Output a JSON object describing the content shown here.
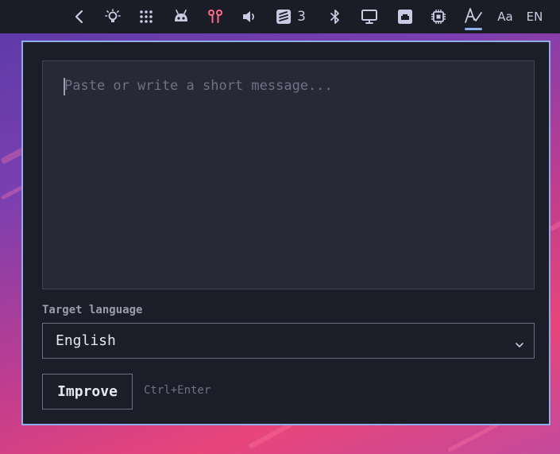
{
  "topbar": {
    "icons": [
      "chevron-left-icon",
      "bulb-icon",
      "grid-icon",
      "robot-icon",
      "earbuds-icon",
      "speaker-icon",
      "stack-icon",
      "bluetooth-icon",
      "monitor-icon",
      "ethernet-icon",
      "chip-icon",
      "signature-icon"
    ],
    "stack_count": "3",
    "font_label": "Aa",
    "lang_label": "EN",
    "accent_color": "#8fb3ee",
    "earbuds_color": "#ff6b8a"
  },
  "editor": {
    "placeholder": "Paste or write a short message..."
  },
  "target_language": {
    "label": "Target language",
    "selected": "English"
  },
  "actions": {
    "improve_label": "Improve",
    "shortcut_hint": "Ctrl+Enter"
  }
}
